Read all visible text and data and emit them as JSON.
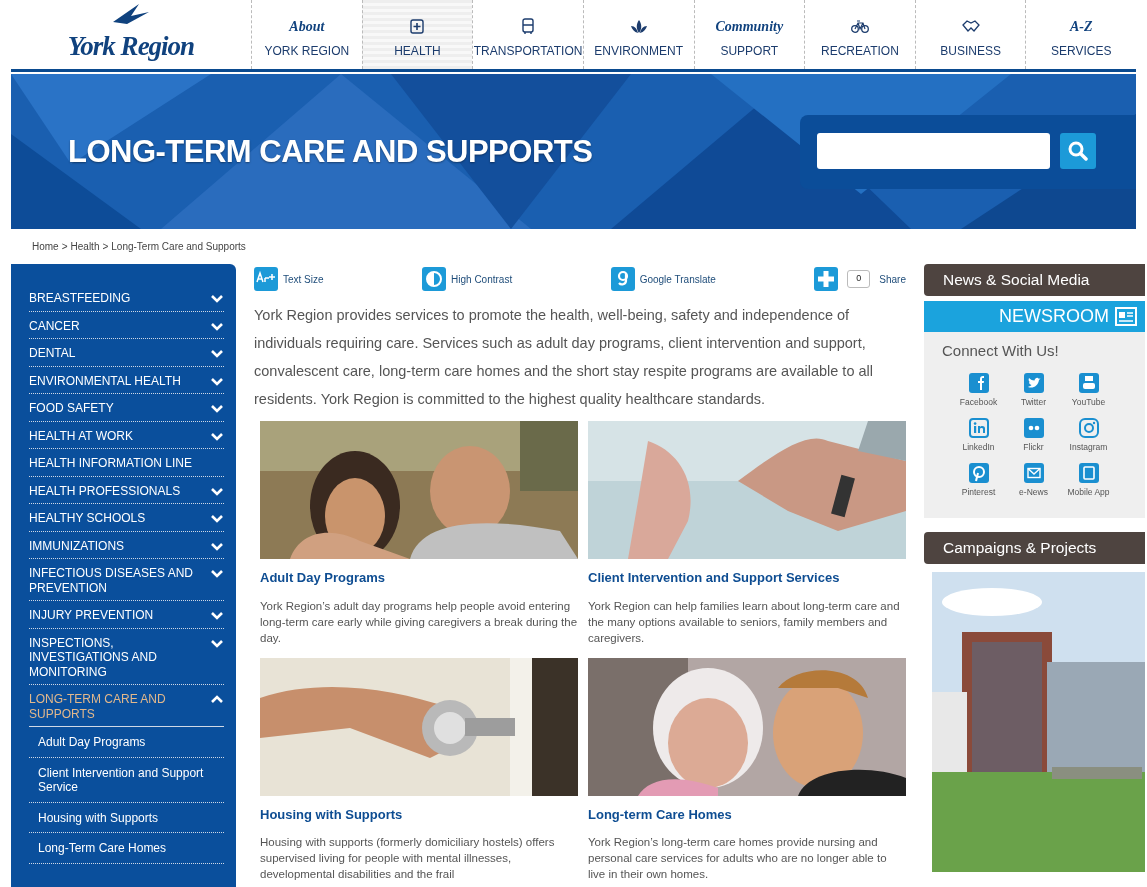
{
  "logo": {
    "text": "York Region"
  },
  "nav": [
    {
      "top": "About",
      "label": "YORK REGION",
      "kind": "text",
      "selected": false
    },
    {
      "label": "HEALTH",
      "kind": "icon",
      "selected": true
    },
    {
      "label": "TRANSPORTATION",
      "kind": "icon",
      "selected": false
    },
    {
      "label": "ENVIRONMENT",
      "kind": "icon",
      "selected": false
    },
    {
      "top": "Community",
      "label": "SUPPORT",
      "kind": "text",
      "selected": false
    },
    {
      "label": "RECREATION",
      "kind": "icon",
      "selected": false
    },
    {
      "label": "BUSINESS",
      "kind": "icon",
      "selected": false
    },
    {
      "top": "A-Z",
      "label": "SERVICES",
      "kind": "text",
      "selected": false
    }
  ],
  "banner": {
    "title": "LONG-TERM CARE AND SUPPORTS"
  },
  "breadcrumb": [
    "Home",
    "Health",
    "Long-Term Care and Supports"
  ],
  "breadcrumb_separator": ">",
  "sidebar": {
    "items": [
      {
        "label": "BREASTFEEDING",
        "expandable": true,
        "expanded": false,
        "selected": false
      },
      {
        "label": "CANCER",
        "expandable": true,
        "expanded": false,
        "selected": false
      },
      {
        "label": "DENTAL",
        "expandable": true,
        "expanded": false,
        "selected": false
      },
      {
        "label": "ENVIRONMENTAL HEALTH",
        "expandable": true,
        "expanded": false,
        "selected": false
      },
      {
        "label": "FOOD SAFETY",
        "expandable": true,
        "expanded": false,
        "selected": false
      },
      {
        "label": "HEALTH AT WORK",
        "expandable": true,
        "expanded": false,
        "selected": false
      },
      {
        "label": "HEALTH INFORMATION LINE",
        "expandable": false,
        "selected": false
      },
      {
        "label": "HEALTH PROFESSIONALS",
        "expandable": true,
        "expanded": false,
        "selected": false
      },
      {
        "label": "HEALTHY SCHOOLS",
        "expandable": true,
        "expanded": false,
        "selected": false
      },
      {
        "label": "IMMUNIZATIONS",
        "expandable": true,
        "expanded": false,
        "selected": false
      },
      {
        "label": "INFECTIOUS DISEASES AND PREVENTION",
        "expandable": true,
        "expanded": false,
        "selected": false
      },
      {
        "label": "INJURY PREVENTION",
        "expandable": true,
        "expanded": false,
        "selected": false
      },
      {
        "label": "INSPECTIONS, INVESTIGATIONS AND MONITORING",
        "expandable": true,
        "expanded": false,
        "selected": false
      },
      {
        "label": "LONG-TERM CARE AND SUPPORTS",
        "expandable": true,
        "expanded": true,
        "selected": true,
        "children": [
          {
            "label": "Adult Day Programs"
          },
          {
            "label": "Client Intervention and Support Service"
          },
          {
            "label": "Housing with Supports"
          },
          {
            "label": "Long-Term Care Homes"
          }
        ]
      }
    ]
  },
  "tools": [
    {
      "label": "Text Size"
    },
    {
      "label": "High Contrast"
    },
    {
      "label": "Google Translate"
    },
    {
      "label": "Share",
      "count": "0"
    }
  ],
  "intro": "York Region provides services to promote the health, well-being, safety and independence of individuals requiring care. Services such as adult day programs, client intervention and support, convalescent care, long-term care homes and the short stay respite programs are available to all residents. York Region is committed to the highest quality healthcare standards.",
  "cards": [
    {
      "title": "Adult Day Programs",
      "text": "York Region’s adult day programs help people avoid entering long-term care early while giving caregivers a break during the day.",
      "kind": "picture"
    },
    {
      "title": "Client Intervention and Support Services",
      "text": "York Region can help families learn about long-term care and the many options available to seniors, family members and caregivers.",
      "kind": "picture"
    },
    {
      "title": "Housing with Supports",
      "text": "Housing with supports (formerly domiciliary hostels) offers supervised living for people with mental illnesses, developmental disabilities and the frail",
      "kind": "picture"
    },
    {
      "title": "Long-term Care Homes",
      "text": "York Region’s long-term care homes provide nursing and personal care services for adults who are no longer able to live in their own homes.",
      "kind": "picture"
    }
  ],
  "news": {
    "heading": "News & Social Media",
    "newsroom": "NEWSROOM",
    "connect": "Connect With Us!",
    "social": [
      {
        "label": "Facebook"
      },
      {
        "label": "Twitter"
      },
      {
        "label": "YouTube"
      },
      {
        "label": "LinkedIn"
      },
      {
        "label": "Flickr"
      },
      {
        "label": "Instagram"
      },
      {
        "label": "Pinterest"
      },
      {
        "label": "e-News"
      },
      {
        "label": "Mobile App"
      }
    ]
  },
  "campaigns": {
    "heading": "Campaigns & Projects",
    "kind": "picture"
  }
}
